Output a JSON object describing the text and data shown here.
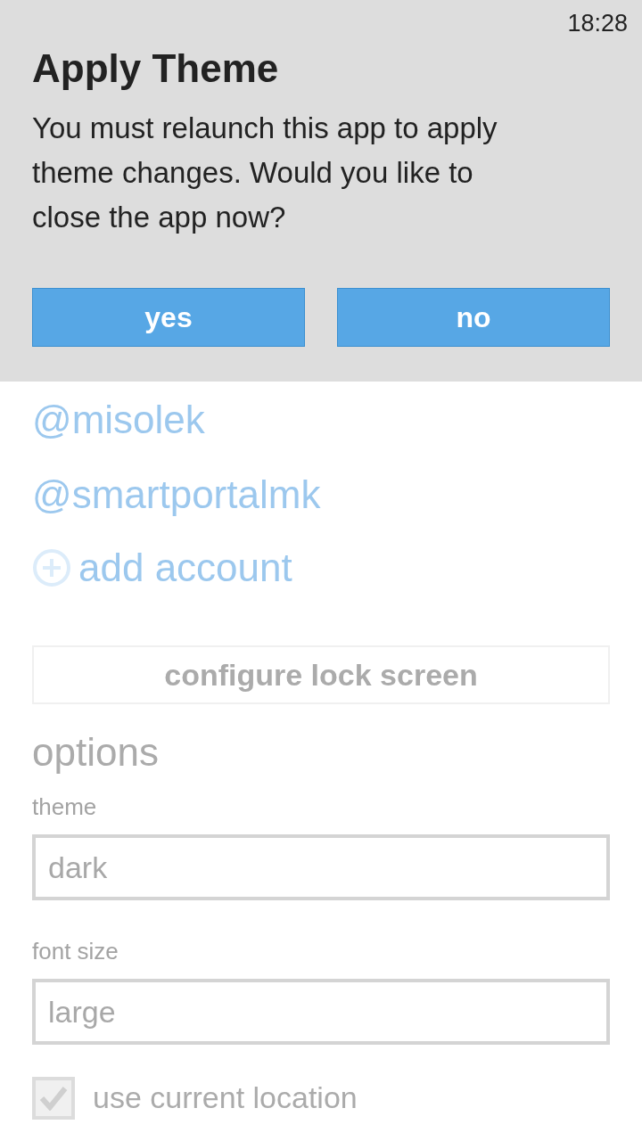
{
  "status_bar": {
    "time": "18:28"
  },
  "dialog": {
    "title": "Apply Theme",
    "message": "You must relaunch this app to apply theme changes. Would you like to close the app now?",
    "buttons": [
      "yes",
      "no"
    ]
  },
  "accounts": [
    "@misolek",
    "@smartportalmk"
  ],
  "add_account": {
    "label": "add account"
  },
  "lock_screen_button": {
    "label": "configure lock screen"
  },
  "options": {
    "heading": "options",
    "fields": [
      {
        "label": "theme",
        "value": "dark"
      },
      {
        "label": "font size",
        "value": "large"
      }
    ],
    "checkbox": {
      "label": "use current location",
      "checked": true
    }
  }
}
